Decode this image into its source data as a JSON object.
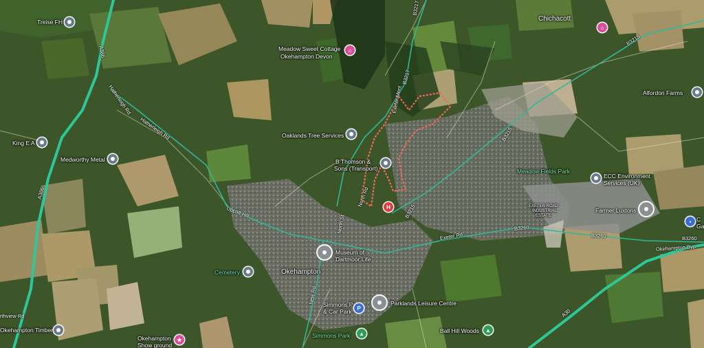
{
  "map": {
    "towns": {
      "okehampton": "Okehampton",
      "chichacott": "Chichacott"
    },
    "places": {
      "treise_fh": "Treise FH",
      "meadow_sweet": [
        "Meadow Sweet Cottage",
        "Okehampton Devon"
      ],
      "oaklands": "Oaklands Tree Services",
      "b_thomson": [
        "B Thomson &",
        "Sons (Transport)"
      ],
      "king_e_a": "King E A",
      "medworthy": "Medworthy Metal",
      "alfordon": "Alfordon Farms",
      "ecc": [
        "ECC Environment",
        "Services (UK)"
      ],
      "farmer_luxtons": "Farmer Luxtons",
      "museum": [
        "Museum of",
        "Dartmoor Life"
      ],
      "cemetery": "Cemetery",
      "simmons_car_park": [
        "Simmons Park",
        "& Car Park"
      ],
      "parklands": "Parklands Leisure Centre",
      "simmons_park": "Simmons Park",
      "ball_hill": "Ball Hill Woods",
      "okehampton_timber": "Okehampton Timber",
      "showground": [
        "Okehampton",
        "Show ground"
      ],
      "meadow_fields_park": "Meadow Fields Park",
      "exeter_road_industrial": [
        "EXETER ROAD",
        "INDUSTRIAL",
        "ESTATE"
      ],
      "edge_label": "C",
      "edge_label2": "Ga"
    },
    "roads": {
      "a386_a": "A386",
      "a386_b": "A386",
      "hatherleigh_rd_a": "Hatherleigh Rd",
      "hatherleigh_rd_b": "Hatherleigh Rd",
      "upcott_hill": "Upcott Hill",
      "b3217_a": "B3217",
      "b3217_b": "B3217",
      "exeter_rd": "Exeter Rd",
      "exeter_rd_2": "Exeter Rd",
      "b3215_a": "B3215",
      "b3215_b": "B3215",
      "b3215_c": "B3215",
      "b3260_a": "B3260",
      "b3260_b": "B3260",
      "b3260_c": "B3260",
      "okehampton_byp": "Okehampton Byp",
      "a30": "A30",
      "north_st": "North St",
      "north_rd": "North Rd",
      "new_rd": "New Rd",
      "north_view_rd": "rthview Rd",
      "exeter_ment": "Exeter Ment"
    },
    "pin_glyphs": {
      "hospital": "H",
      "parking": "P",
      "apartment": "⌂",
      "tree": "▲",
      "info": "●"
    },
    "colors": {
      "highway": "#2ec79a",
      "boundary": "#f26a5b",
      "pin_pink": "#d64f9a",
      "pin_green": "#2f9e5a",
      "pin_grey": "#6b7a8a"
    }
  }
}
